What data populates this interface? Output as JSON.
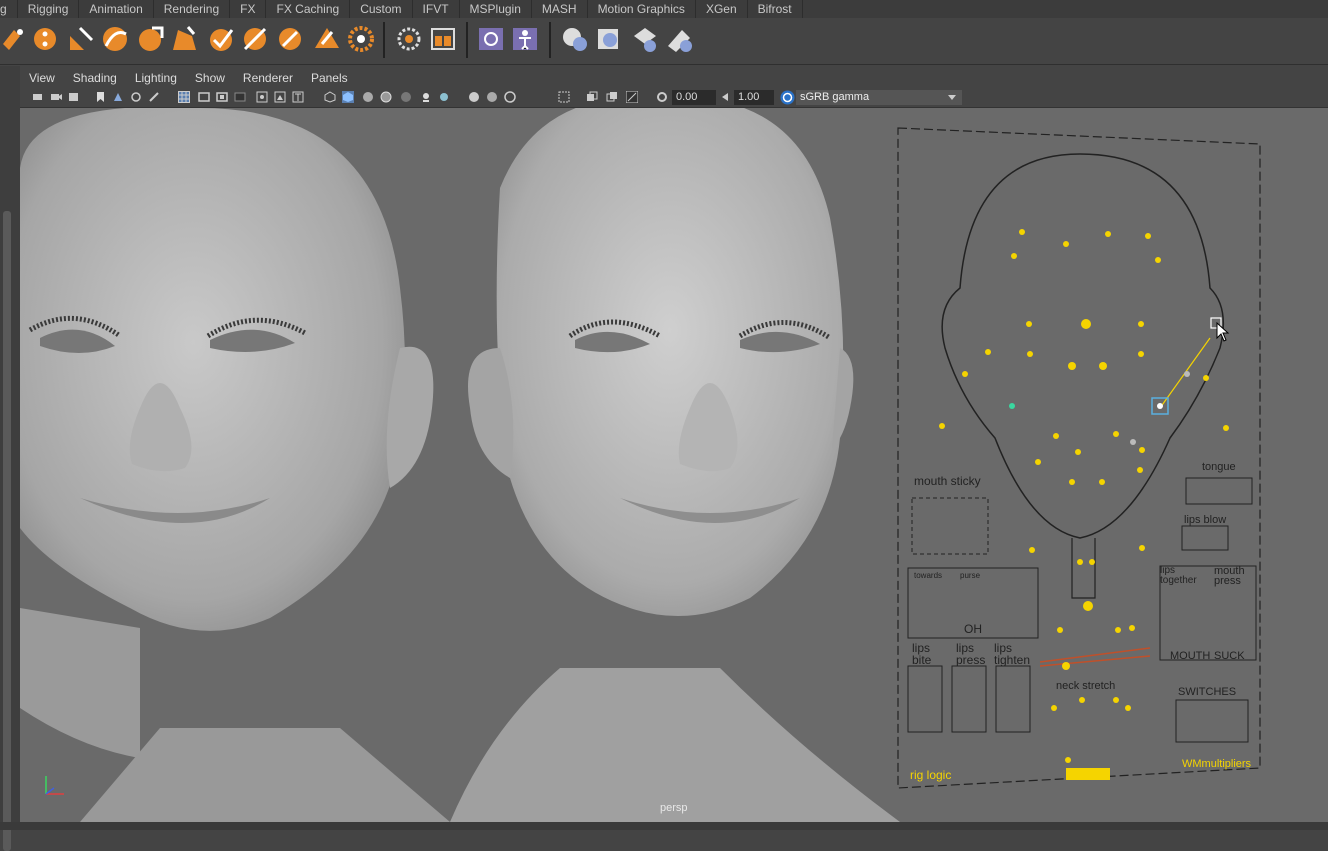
{
  "shelf_tabs": [
    "g",
    "Rigging",
    "Animation",
    "Rendering",
    "FX",
    "FX Caching",
    "Custom",
    "IFVT",
    "MSPlugin",
    "MASH",
    "Motion Graphics",
    "XGen",
    "Bifrost"
  ],
  "panel_menu": [
    "View",
    "Shading",
    "Lighting",
    "Show",
    "Renderer",
    "Panels"
  ],
  "toolbar": {
    "exposure": "0.00",
    "gamma": "1.00",
    "colorspace": "sGRB gamma"
  },
  "viewport": {
    "camera": "persp"
  },
  "picker": {
    "mouth_sticky": "mouth sticky",
    "tongue": "tongue",
    "lips_blow": "lips blow",
    "towards": "towards",
    "purse": "purse",
    "oh": "OH",
    "lips_together": "lips together",
    "mouth_press": "mouth press",
    "mouth_suck_a": "MOUTH",
    "mouth_suck_b": "SUCK",
    "lips_bite": "lips bite",
    "lips_press": "lips press",
    "lips_tighten": "lips tighten",
    "neck_stretch": "neck stretch",
    "switches": "SWITCHES",
    "rig_logic": "rig logic",
    "wm_multipliers": "WMmultipliers"
  },
  "colors": {
    "accent": "#e88a2a",
    "control": "#f5d400",
    "viewport_bg": "#6a6a6a"
  }
}
